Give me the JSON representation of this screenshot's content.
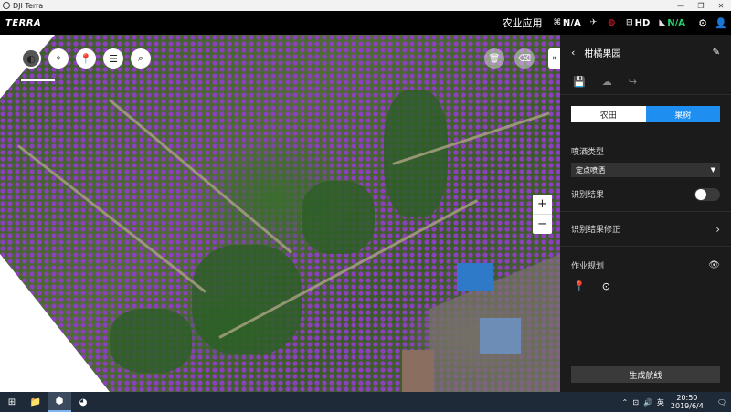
{
  "window": {
    "title": "DJI Terra",
    "controls": [
      "—",
      "❐",
      "✕"
    ]
  },
  "app_bar": {
    "logo": "TERRA",
    "mode": "农业应用",
    "status": [
      {
        "icon": "rc-signal-icon",
        "glyph": "⌘",
        "value": "N/A"
      },
      {
        "icon": "satellite-icon",
        "glyph": "✈",
        "value": ""
      },
      {
        "icon": "rtk-icon",
        "glyph": "◍",
        "value": ""
      },
      {
        "icon": "hd-link-icon",
        "glyph": "⊟",
        "value": "HD"
      },
      {
        "icon": "battery-icon",
        "glyph": "◣",
        "value": "N/A"
      }
    ],
    "settings_glyph": "⚙",
    "user_glyph": "👤"
  },
  "map": {
    "tools": [
      {
        "name": "map-layer-icon",
        "glyph": "◐"
      },
      {
        "name": "locate-icon",
        "glyph": "⌖"
      },
      {
        "name": "location-pin-icon",
        "glyph": "📍"
      },
      {
        "name": "list-icon",
        "glyph": "☰"
      },
      {
        "name": "search-icon",
        "glyph": "⌕"
      }
    ],
    "right_tools": [
      {
        "name": "delete-icon",
        "glyph": "🗑"
      },
      {
        "name": "eraser-icon",
        "glyph": "⌫"
      }
    ],
    "collapse_glyph": "»",
    "zoom_in": "+",
    "zoom_out": "−"
  },
  "panel": {
    "title": "柑橘果园",
    "back_glyph": "‹",
    "edit_glyph": "✎",
    "actions": [
      {
        "name": "save-icon",
        "glyph": "💾",
        "dim": false
      },
      {
        "name": "upload-icon",
        "glyph": "☁",
        "dim": true
      },
      {
        "name": "share-icon",
        "glyph": "↪",
        "dim": true
      }
    ],
    "segments": {
      "farmland": "农田",
      "orchard": "果树",
      "selected": "orchard"
    },
    "spray_type_label": "喷洒类型",
    "spray_type_value": "定点喷洒",
    "recognition_label": "识别结果",
    "recognition_on": false,
    "correction_label": "识别结果修正",
    "plan_label": "作业规划",
    "generate_button": "生成航线"
  },
  "taskbar": {
    "start_glyph": "⊞",
    "apps": [
      {
        "name": "file-explorer-icon",
        "glyph": "📁",
        "active": false
      },
      {
        "name": "dji-terra-taskbar-icon",
        "glyph": "⬢",
        "active": true
      },
      {
        "name": "app-taskbar-icon",
        "glyph": "◕",
        "active": false
      }
    ],
    "tray_icons": [
      "⌃",
      "⊡",
      "🔊"
    ],
    "ime": "英",
    "time": "20:50",
    "date": "2019/6/4",
    "notification_glyph": "🗨"
  }
}
